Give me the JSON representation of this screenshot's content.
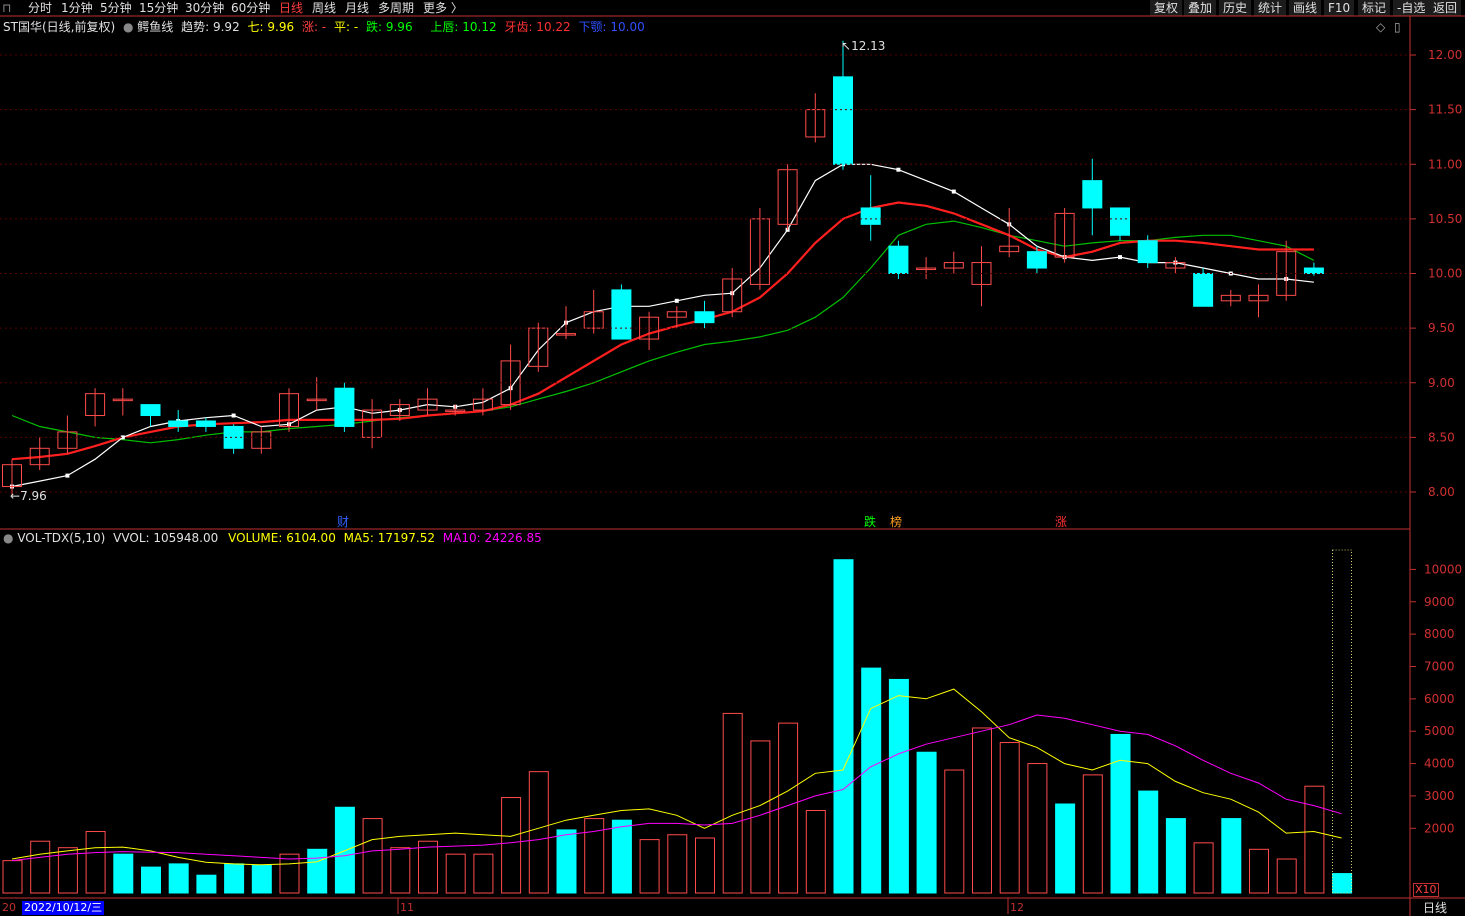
{
  "toolbar": {
    "left_items": [
      "分时",
      "1分钟",
      "5分钟",
      "15分钟",
      "30分钟",
      "60分钟",
      "日线",
      "周线",
      "月线",
      "多周期",
      "更多 〉"
    ],
    "active": "日线",
    "right_items": [
      "复权",
      "叠加",
      "历史",
      "统计",
      "画线",
      "F10",
      "标记",
      "-自选",
      "返回"
    ]
  },
  "price_panel": {
    "stock": "ST国华(日线,前复权)",
    "indicator": "鳄鱼线",
    "trend": "趋势: 9.92",
    "qi": "七: 9.96",
    "zhang": "涨: -",
    "ping": "平: -",
    "die": "跌: 9.96",
    "upper": "上唇: 10.12",
    "teeth": "牙齿: 10.22",
    "lower": "下颚: 10.00",
    "high_label": "12.13",
    "low_label": "7.96",
    "markers": {
      "cai": "财",
      "die": "跌",
      "bang": "榜",
      "zhang": "涨"
    }
  },
  "volume_panel": {
    "indicator": "VOL-TDX(5,10)",
    "vvol": "VVOL: 105948.00",
    "volume": "VOLUME: 6104.00",
    "ma5": "MA5: 17197.52",
    "ma10": "MA10: 24226.85",
    "multiplier": "X10"
  },
  "bottom": {
    "date_cursor": "2022/10/12/三",
    "month_11": "11",
    "month_12": "12",
    "period": "日线",
    "left_tick": "20"
  },
  "colors": {
    "up": "#ff4b4b",
    "down": "#00ffff",
    "jaw": "#00c000",
    "teeth": "#ff1f1f",
    "lips": "#ffffff",
    "ma5": "#ffff00",
    "ma10": "#ff00ff",
    "volume_text": "#ffff00",
    "axis": "#c03030"
  },
  "chart_data": [
    {
      "type": "candlestick",
      "title": "ST国华(日线,前复权)",
      "ylim": [
        7.8,
        12.2
      ],
      "y_ticks": [
        8.0,
        8.5,
        9.0,
        9.5,
        10.0,
        10.5,
        11.0,
        11.5,
        12.0
      ],
      "x_labels": [
        "20",
        "11",
        "12"
      ],
      "candles": [
        [
          8.05,
          8.25,
          8.3,
          7.96
        ],
        [
          8.25,
          8.4,
          8.5,
          8.2
        ],
        [
          8.4,
          8.55,
          8.7,
          8.35
        ],
        [
          8.7,
          8.9,
          8.95,
          8.6
        ],
        [
          8.85,
          8.85,
          8.95,
          8.7
        ],
        [
          8.8,
          8.7,
          8.8,
          8.6
        ],
        [
          8.65,
          8.6,
          8.75,
          8.55
        ],
        [
          8.65,
          8.6,
          8.68,
          8.55
        ],
        [
          8.6,
          8.4,
          8.62,
          8.35
        ],
        [
          8.4,
          8.55,
          8.6,
          8.35
        ],
        [
          8.6,
          8.9,
          8.95,
          8.55
        ],
        [
          8.85,
          8.85,
          9.05,
          8.75
        ],
        [
          8.95,
          8.6,
          9.0,
          8.55
        ],
        [
          8.5,
          8.75,
          8.85,
          8.4
        ],
        [
          8.7,
          8.8,
          8.85,
          8.65
        ],
        [
          8.75,
          8.85,
          8.95,
          8.7
        ],
        [
          8.75,
          8.75,
          8.8,
          8.7
        ],
        [
          8.75,
          8.85,
          8.95,
          8.7
        ],
        [
          8.8,
          9.2,
          9.35,
          8.75
        ],
        [
          9.15,
          9.5,
          9.55,
          9.1
        ],
        [
          9.45,
          9.45,
          9.7,
          9.4
        ],
        [
          9.5,
          9.65,
          9.85,
          9.45
        ],
        [
          9.85,
          9.4,
          9.9,
          9.4
        ],
        [
          9.4,
          9.6,
          9.65,
          9.3
        ],
        [
          9.6,
          9.65,
          9.7,
          9.5
        ],
        [
          9.65,
          9.55,
          9.75,
          9.5
        ],
        [
          9.65,
          9.95,
          10.05,
          9.6
        ],
        [
          9.9,
          10.5,
          10.6,
          9.85
        ],
        [
          10.45,
          10.95,
          11.0,
          10.4
        ],
        [
          11.25,
          11.5,
          11.65,
          11.2
        ],
        [
          11.8,
          11.0,
          12.13,
          10.95
        ],
        [
          10.6,
          10.45,
          10.9,
          10.3
        ],
        [
          10.25,
          10.0,
          10.3,
          9.95
        ],
        [
          10.05,
          10.05,
          10.15,
          9.95
        ],
        [
          10.05,
          10.1,
          10.2,
          10.0
        ],
        [
          9.9,
          10.1,
          10.25,
          9.7
        ],
        [
          10.2,
          10.25,
          10.6,
          10.15
        ],
        [
          10.2,
          10.05,
          10.25,
          10.0
        ],
        [
          10.15,
          10.55,
          10.6,
          10.1
        ],
        [
          10.85,
          10.6,
          11.05,
          10.35
        ],
        [
          10.6,
          10.35,
          10.6,
          10.3
        ],
        [
          10.3,
          10.1,
          10.35,
          10.05
        ],
        [
          10.05,
          10.1,
          10.15,
          10.0
        ],
        [
          10.0,
          9.7,
          10.05,
          9.7
        ],
        [
          9.75,
          9.8,
          9.85,
          9.7
        ],
        [
          9.75,
          9.8,
          9.9,
          9.6
        ],
        [
          9.8,
          10.2,
          10.3,
          9.75
        ],
        [
          10.05,
          10.0,
          10.1,
          9.98
        ]
      ],
      "series": [
        {
          "name": "趋势",
          "values": [
            8.05,
            8.1,
            8.15,
            8.3,
            8.5,
            8.6,
            8.65,
            8.68,
            8.7,
            8.6,
            8.62,
            8.75,
            8.78,
            8.72,
            8.75,
            8.8,
            8.78,
            8.82,
            8.95,
            9.3,
            9.55,
            9.65,
            9.7,
            9.7,
            9.75,
            9.8,
            9.82,
            10.05,
            10.4,
            10.85,
            11.0,
            11.0,
            10.95,
            10.85,
            10.75,
            10.6,
            10.45,
            10.25,
            10.15,
            10.12,
            10.15,
            10.1,
            10.1,
            10.05,
            10.0,
            9.95,
            9.95,
            9.92
          ]
        },
        {
          "name": "牙齿",
          "values": [
            8.3,
            8.32,
            8.35,
            8.42,
            8.5,
            8.55,
            8.6,
            8.62,
            8.63,
            8.64,
            8.66,
            8.66,
            8.66,
            8.66,
            8.67,
            8.7,
            8.72,
            8.74,
            8.8,
            8.9,
            9.05,
            9.2,
            9.35,
            9.45,
            9.52,
            9.58,
            9.65,
            9.78,
            10.0,
            10.28,
            10.5,
            10.6,
            10.65,
            10.62,
            10.55,
            10.45,
            10.35,
            10.22,
            10.15,
            10.2,
            10.28,
            10.3,
            10.3,
            10.28,
            10.25,
            10.22,
            10.22,
            10.22
          ]
        },
        {
          "name": "下颚",
          "values": [
            8.7,
            8.6,
            8.55,
            8.5,
            8.48,
            8.45,
            8.48,
            8.52,
            8.55,
            8.55,
            8.58,
            8.6,
            8.62,
            8.65,
            8.68,
            8.7,
            8.72,
            8.74,
            8.78,
            8.85,
            8.92,
            9.0,
            9.1,
            9.2,
            9.28,
            9.35,
            9.38,
            9.42,
            9.48,
            9.6,
            9.78,
            10.05,
            10.35,
            10.45,
            10.48,
            10.42,
            10.35,
            10.3,
            10.25,
            10.28,
            10.3,
            10.3,
            10.33,
            10.35,
            10.35,
            10.3,
            10.25,
            10.12
          ]
        }
      ]
    },
    {
      "type": "bar",
      "title": "VOL-TDX(5,10)",
      "ylim": [
        0,
        10600
      ],
      "y_ticks": [
        2000,
        3000,
        4000,
        5000,
        6000,
        7000,
        8000,
        9000,
        10000
      ],
      "values": [
        1000,
        1600,
        1400,
        1900,
        1200,
        800,
        900,
        550,
        900,
        850,
        1200,
        1350,
        2650,
        2300,
        1400,
        1600,
        1200,
        1200,
        2950,
        3750,
        1950,
        2300,
        2250,
        1650,
        1800,
        1700,
        5550,
        4700,
        5250,
        2550,
        10300,
        6950,
        6600,
        4350,
        3800,
        5100,
        4650,
        4000,
        2750,
        3650,
        4900,
        3150,
        2300,
        1550,
        2300,
        1350,
        1050,
        3300,
        600
      ],
      "up": [
        1,
        1,
        1,
        1,
        0,
        0,
        0,
        0,
        0,
        0,
        1,
        0,
        0,
        1,
        1,
        1,
        1,
        1,
        1,
        1,
        0,
        1,
        0,
        1,
        1,
        1,
        1,
        1,
        1,
        1,
        0,
        0,
        0,
        0,
        1,
        1,
        1,
        1,
        0,
        1,
        0,
        0,
        0,
        1,
        0,
        1,
        1,
        1,
        0
      ],
      "series": [
        {
          "name": "MA5",
          "values": [
            1050,
            1200,
            1300,
            1400,
            1420,
            1300,
            1100,
            950,
            900,
            870,
            900,
            960,
            1300,
            1650,
            1750,
            1800,
            1850,
            1800,
            1750,
            2000,
            2250,
            2400,
            2550,
            2600,
            2400,
            2000,
            2400,
            2700,
            3150,
            3700,
            3800,
            5700,
            6100,
            6000,
            6300,
            5600,
            4800,
            4500,
            4000,
            3800,
            4100,
            4000,
            3450,
            3100,
            2900,
            2500,
            1850,
            1900,
            1700
          ]
        },
        {
          "name": "MA10",
          "values": [
            1000,
            1100,
            1200,
            1250,
            1280,
            1260,
            1250,
            1200,
            1150,
            1100,
            1050,
            1080,
            1150,
            1300,
            1350,
            1420,
            1450,
            1480,
            1550,
            1650,
            1800,
            1900,
            2050,
            2150,
            2150,
            2100,
            2150,
            2400,
            2700,
            3000,
            3200,
            3900,
            4300,
            4600,
            4800,
            5000,
            5200,
            5500,
            5400,
            5200,
            5000,
            4900,
            4550,
            4100,
            3700,
            3400,
            2900,
            2700,
            2450
          ]
        }
      ]
    }
  ]
}
